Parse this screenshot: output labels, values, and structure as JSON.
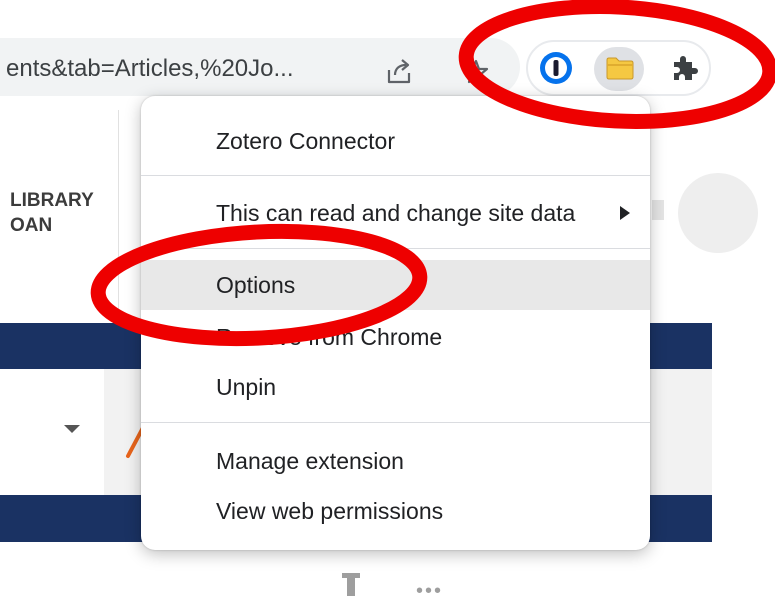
{
  "browser": {
    "url_text": "ents&tab=Articles,%20Jo...",
    "extensions": [
      "1Password",
      "Zotero Connector",
      "Extensions"
    ]
  },
  "page": {
    "library_label_line1": "LIBRARY",
    "library_label_line2": "OAN"
  },
  "context_menu": {
    "title": "Zotero Connector",
    "site_access": "This can read and change site data",
    "options": "Options",
    "remove": "Remove from Chrome",
    "unpin": "Unpin",
    "manage": "Manage extension",
    "permissions": "View web permissions"
  },
  "colors": {
    "annotation": "#ee0000",
    "navy_band": "#1a3263",
    "hover_bg": "#e8e8e8",
    "zotero_folder": "#f5c842"
  },
  "icons": [
    "share-icon",
    "star-icon",
    "onepassword-icon",
    "zotero-icon",
    "puzzle-icon",
    "chevron-right-icon",
    "dropdown-arrow-icon"
  ]
}
